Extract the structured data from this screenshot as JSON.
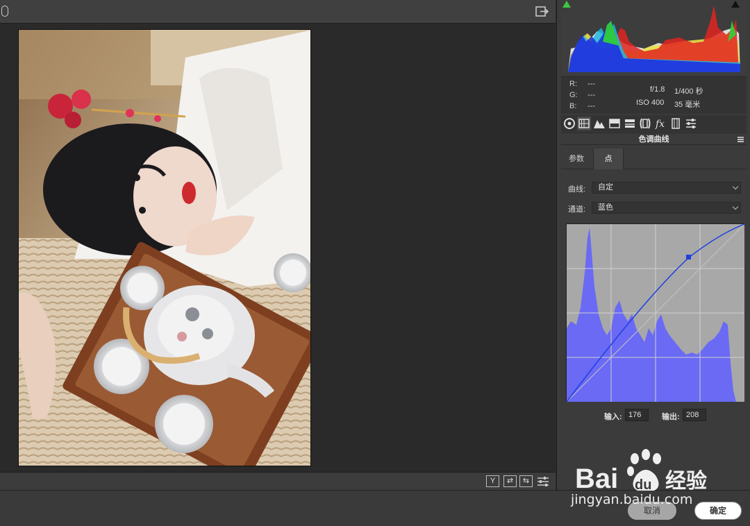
{
  "panel": {
    "info": {
      "r_label": "R:",
      "g_label": "G:",
      "b_label": "B:",
      "r_value": "---",
      "g_value": "---",
      "b_value": "---",
      "aperture": "f/1.8",
      "shutter": "1/400 秒",
      "iso": "ISO 400",
      "focal": "35 毫米"
    },
    "section_title": "色调曲线",
    "subtabs": [
      {
        "label": "参数",
        "active": false
      },
      {
        "label": "点",
        "active": true
      }
    ],
    "curve_label": "曲线:",
    "curve_value": "自定",
    "channel_label": "通道:",
    "channel_value": "蓝色",
    "input_label": "输入:",
    "input_value": "176",
    "output_label": "输出:",
    "output_value": "208",
    "tool_icons": [
      "aperture-icon",
      "grid-icon",
      "mountains-icon",
      "split-box-icon",
      "split-line-icon",
      "lens-icon",
      "fx-icon",
      "film-icon",
      "sliders-icon"
    ]
  },
  "canvas_footer": {
    "buttons": [
      "Y",
      "⇄",
      "⇆"
    ]
  },
  "dialog": {
    "cancel": "取消",
    "ok": "确定"
  },
  "watermark": {
    "logo_text": "Bai 经验",
    "url": "jingyan.baidu.com"
  },
  "colors": {
    "curve_blue": "#1f3fe0",
    "histogram_blue": "#6a6af5",
    "panel_bg": "#3b3b3b"
  }
}
